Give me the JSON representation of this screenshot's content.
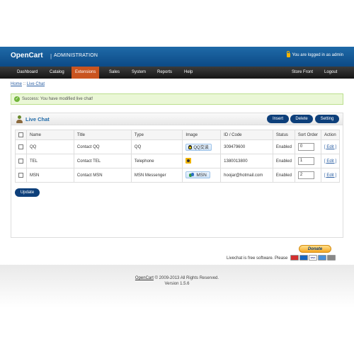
{
  "header": {
    "logo": "OpenCart",
    "separator": "|",
    "title": "ADMINISTRATION",
    "logged_in": "You are logged in as admin",
    "lock_icon": "lock-icon"
  },
  "menu": {
    "left": [
      "Dashboard",
      "Catalog",
      "Extensions",
      "Sales",
      "System",
      "Reports",
      "Help"
    ],
    "active": "Extensions",
    "right": [
      "Store Front",
      "Logout"
    ]
  },
  "breadcrumb": {
    "home": "Home",
    "separator": "::",
    "current": "Live Chat"
  },
  "alert": {
    "message": "Success: You have modified live chat!",
    "icon": "check-circle-icon"
  },
  "panel": {
    "title": "Live Chat",
    "icon": "user-icon",
    "buttons": {
      "insert": "Insert",
      "delete": "Delete",
      "setting": "Setting"
    },
    "columns": [
      "Name",
      "Title",
      "Type",
      "Image",
      "ID / Code",
      "Status",
      "Sort Order",
      "Action"
    ],
    "rows": [
      {
        "name": "QQ",
        "title": "Contact QQ",
        "type": "QQ",
        "image_text": "QQ交谈",
        "image_icon": "qq-penguin-icon",
        "id": "309479600",
        "status": "Enabled",
        "sort": "0",
        "action": "[ Edit ]"
      },
      {
        "name": "TEL",
        "title": "Contact TEL",
        "type": "Telephone",
        "image_text": "",
        "image_icon": "telephone-icon",
        "id": "1380013800",
        "status": "Enabled",
        "sort": "1",
        "action": "[ Edit ]"
      },
      {
        "name": "MSN",
        "title": "Contact MSN",
        "type": "MSN Messenger",
        "image_text": "MSN",
        "image_icon": "msn-buddy-icon",
        "id": "hoojar@hotmail.com",
        "status": "Enabled",
        "sort": "2",
        "action": "[ Edit ]"
      }
    ],
    "update": "Update"
  },
  "donate": {
    "button": "Donate",
    "text": "Livechat is free software. Please",
    "cards": [
      "Mastercard",
      "Maestro",
      "VISA",
      "Amex",
      "Bank"
    ]
  },
  "footer": {
    "brand": "OpenCart",
    "copyright": "© 2009-2013 All Rights Reserved.",
    "version": "Version 1.5.6"
  }
}
